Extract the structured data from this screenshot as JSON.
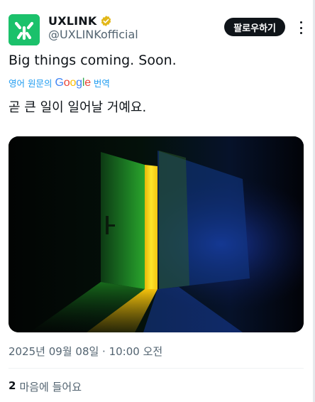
{
  "author": {
    "display_name": "UXLINK",
    "handle": "@UXLINKofficial",
    "verified": true,
    "avatar_color": "#1bc16b"
  },
  "follow_label": "팔로우하기",
  "tweet": {
    "text": "Big things coming. Soon.",
    "translate": {
      "prefix": "영어 원문의",
      "google": "Google",
      "suffix": "번역"
    },
    "translated_text": "곧 큰 일이 일어날 거예요."
  },
  "media": {
    "description_icon": "door-light-image"
  },
  "timestamp": "2025년 09월 08일 · 10:00 오전",
  "likes": {
    "count": "2",
    "label": "마음에 들어요"
  },
  "colors": {
    "accent": "#1d9bf0",
    "text": "#0f1419",
    "secondary": "#536471",
    "verified_gold": "#e2b719"
  }
}
